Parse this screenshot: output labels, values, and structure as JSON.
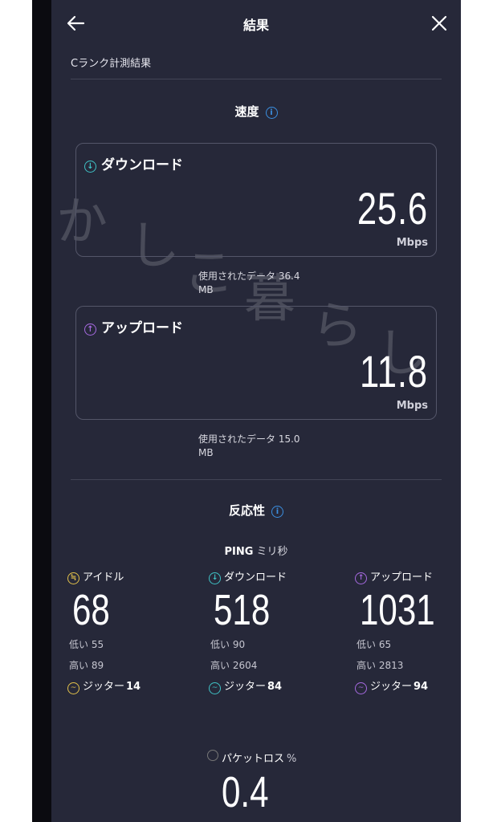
{
  "header": {
    "title": "結果",
    "back_icon": "arrow-left-icon",
    "close_icon": "close-icon"
  },
  "subtitle": "Cランク計測結果",
  "watermark": [
    "かしこ暮らし"
  ],
  "speed": {
    "title": "速度",
    "download": {
      "label": "ダウンロード",
      "value": "25.6",
      "unit": "Mbps",
      "data_used_line1": "使用されたデータ 36.4",
      "data_used_line2": "MB",
      "color": "#3fc2c6"
    },
    "upload": {
      "label": "アップロード",
      "value": "11.8",
      "unit": "Mbps",
      "data_used_line1": "使用されたデータ 15.0",
      "data_used_line2": "MB",
      "color": "#a66ae0"
    }
  },
  "responsiveness": {
    "title": "反応性",
    "ping_label": "PING",
    "ping_unit": "ミリ秒",
    "idle": {
      "label": "アイドル",
      "value": "68",
      "low": "低い 55",
      "high": "高い 89",
      "jitter_label": "ジッター",
      "jitter": "14",
      "color": "#e2c14a"
    },
    "download": {
      "label": "ダウンロード",
      "value": "518",
      "low": "低い 90",
      "high": "高い 2604",
      "jitter_label": "ジッター",
      "jitter": "84",
      "color": "#3fc2c6"
    },
    "upload": {
      "label": "アップロード",
      "value": "1031",
      "low": "低い 65",
      "high": "高い 2813",
      "jitter_label": "ジッター",
      "jitter": "94",
      "color": "#a66ae0"
    }
  },
  "packet_loss": {
    "label": "パケットロス",
    "unit": "%",
    "value": "0.4"
  },
  "colors": {
    "background": "#262839",
    "info": "#3b8fe0"
  }
}
